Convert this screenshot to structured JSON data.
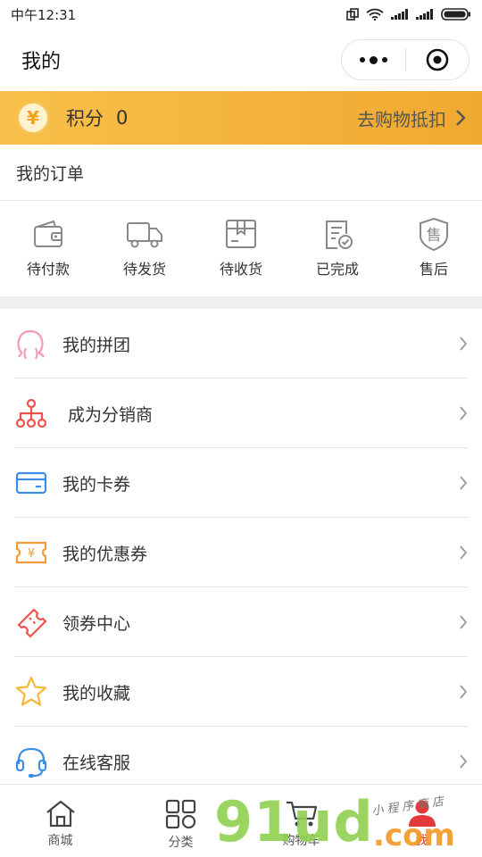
{
  "status_bar": {
    "time": "中午12:31"
  },
  "header": {
    "title": "我的"
  },
  "points": {
    "label": "积分",
    "value": "0",
    "link": "去购物抵扣",
    "coin_symbol": "¥"
  },
  "orders": {
    "title": "我的订单",
    "items": [
      {
        "label": "待付款",
        "icon": "wallet-icon"
      },
      {
        "label": "待发货",
        "icon": "truck-icon"
      },
      {
        "label": "待收货",
        "icon": "package-icon"
      },
      {
        "label": "已完成",
        "icon": "document-check-icon"
      },
      {
        "label": "售后",
        "icon": "after-sale-shield-icon",
        "glyph": "售"
      }
    ]
  },
  "menu": [
    {
      "label": "我的拼团",
      "icon": "group-buy-icon",
      "color": "#f59ab8"
    },
    {
      "label": "成为分销商",
      "icon": "distribution-network-icon",
      "color": "#ef5350"
    },
    {
      "label": "我的卡券",
      "icon": "card-icon",
      "color": "#3a8ee6"
    },
    {
      "label": "我的优惠券",
      "icon": "coupon-icon",
      "color": "#f29b38",
      "glyph": "¥"
    },
    {
      "label": "领券中心",
      "icon": "ticket-icon",
      "color": "#ef5350"
    },
    {
      "label": "我的收藏",
      "icon": "star-icon",
      "color": "#f5b83a"
    },
    {
      "label": "在线客服",
      "icon": "headset-icon",
      "color": "#3a8ee6"
    }
  ],
  "tabs": [
    {
      "label": "商城",
      "icon": "home-icon"
    },
    {
      "label": "分类",
      "icon": "category-grid-icon"
    },
    {
      "label": "购物车",
      "icon": "cart-icon"
    },
    {
      "label": "我",
      "icon": "profile-icon",
      "active": true
    }
  ],
  "watermark": {
    "main": "91ud",
    "suffix": ".com",
    "tagline": "小程序商店"
  },
  "colors": {
    "accent": "#e4393c",
    "points_bar": "#f3b23a"
  }
}
